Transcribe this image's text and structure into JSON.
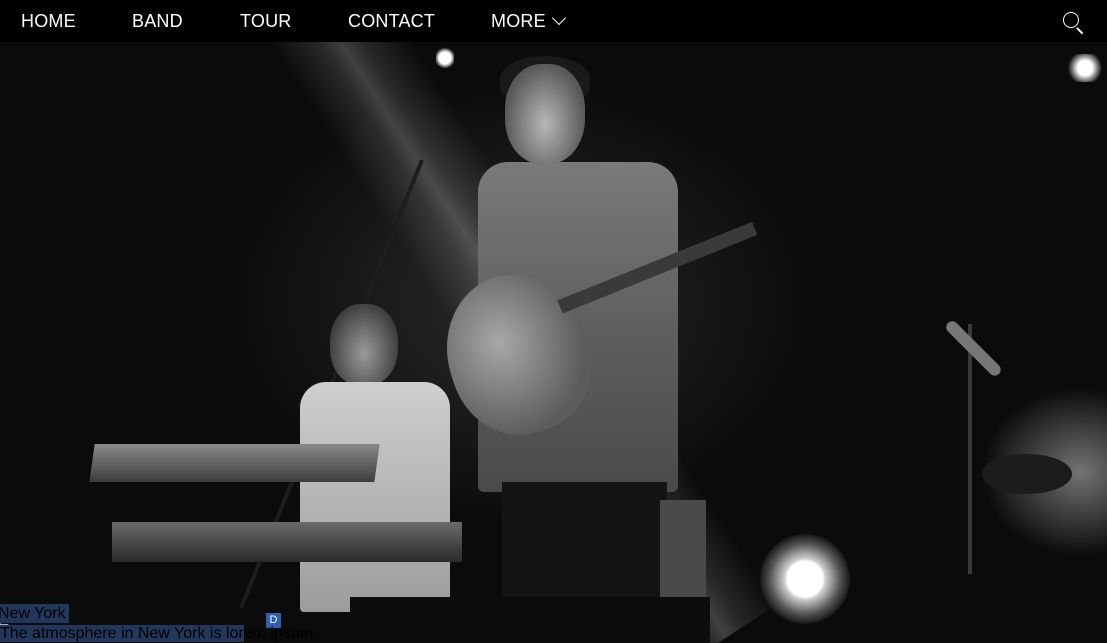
{
  "nav": {
    "items": [
      {
        "label": "HOME"
      },
      {
        "label": "BAND"
      },
      {
        "label": "TOUR"
      },
      {
        "label": "CONTACT"
      },
      {
        "label": "MORE"
      }
    ],
    "search_icon": "search-icon",
    "more_icon": "chevron-down-icon"
  },
  "hero": {
    "badge": "D",
    "caption": {
      "city": "New York",
      "text_selected": "The atmosphere in New York is lor",
      "text_rest": "em ipsum."
    }
  },
  "colors": {
    "nav_bg": "#000000",
    "nav_text": "#ffffff",
    "selection": "#23375c"
  }
}
